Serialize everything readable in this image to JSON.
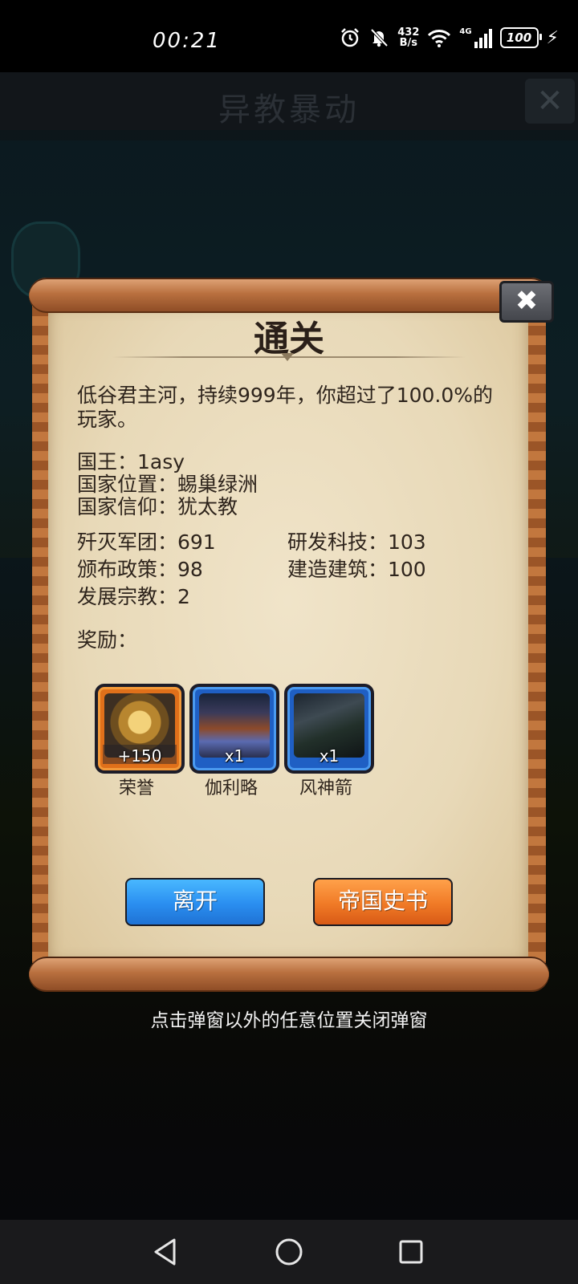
{
  "status_bar": {
    "time": "00:21",
    "net_speed_value": "432",
    "net_speed_unit": "B/s",
    "network_type": "4G",
    "battery": "100",
    "icons": [
      "alarm-icon",
      "mute-bell-icon",
      "wifi-icon",
      "signal-icon",
      "battery-icon",
      "charging-bolt-icon"
    ]
  },
  "game": {
    "title": "异教暴动"
  },
  "popup": {
    "title": "通关",
    "summary": "低谷君主河，持续999年，你超过了100.0%的玩家。",
    "king": "国王：1asy",
    "location": "国家位置：蜴巢绿洲",
    "faith": "国家信仰：犹太教",
    "stats": {
      "legions": "歼灭军团：691",
      "tech": "研发科技：103",
      "policies": "颁布政策：98",
      "buildings": "建造建筑：100",
      "religions": "发展宗教：2"
    },
    "rewards_label": "奖励：",
    "rewards": [
      {
        "name": "荣誉",
        "qty": "+150",
        "frame_color": "#e0701a"
      },
      {
        "name": "伽利略",
        "qty": "x1",
        "frame_color": "#1f5fc4"
      },
      {
        "name": "风神箭",
        "qty": "x1",
        "frame_color": "#1f5fc4"
      }
    ],
    "buttons": {
      "leave": "离开",
      "history": "帝国史书"
    },
    "close_symbol": "✖"
  },
  "hint": "点击弹窗以外的任意位置关闭弹窗",
  "colors": {
    "leave_button": "#2a8ef0",
    "history_button": "#f07a26",
    "paper": "#e8d9b8",
    "scroll_wood": "#b9703f"
  }
}
